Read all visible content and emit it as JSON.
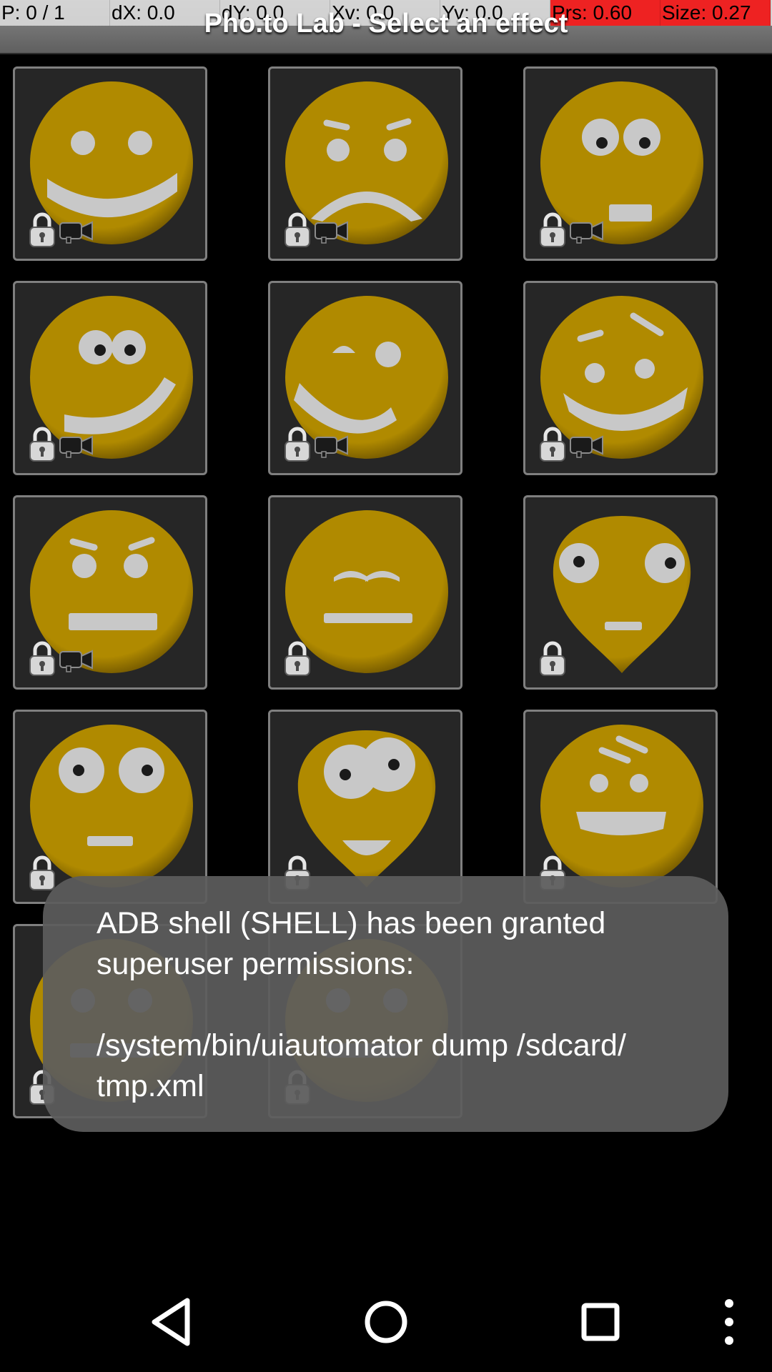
{
  "debug": {
    "cells": [
      {
        "text": "P: 0 / 1",
        "alert": false
      },
      {
        "text": "dX: 0.0",
        "alert": false
      },
      {
        "text": "dY: 0.0",
        "alert": false
      },
      {
        "text": "Xv: 0.0",
        "alert": false
      },
      {
        "text": "Yv: 0.0",
        "alert": false
      },
      {
        "text": "Prs: 0.60",
        "alert": true
      },
      {
        "text": "Size: 0.27",
        "alert": true
      }
    ]
  },
  "app": {
    "title": "Pho.to Lab - Select an effect"
  },
  "colors": {
    "face": "#b08a00",
    "face_dark": "#6e5400",
    "feature": "#c8c8c8",
    "pupil": "#1a1a1a"
  },
  "effects": [
    {
      "expression": "smile",
      "locked": true,
      "video": true
    },
    {
      "expression": "sad",
      "locked": true,
      "video": true
    },
    {
      "expression": "surprised",
      "locked": true,
      "video": true
    },
    {
      "expression": "crooked-smile",
      "locked": true,
      "video": true
    },
    {
      "expression": "wink",
      "locked": true,
      "video": true
    },
    {
      "expression": "smirk",
      "locked": true,
      "video": true
    },
    {
      "expression": "worried-flat",
      "locked": true,
      "video": true
    },
    {
      "expression": "bored",
      "locked": true,
      "video": false
    },
    {
      "expression": "alien",
      "locked": true,
      "video": false
    },
    {
      "expression": "stare",
      "locked": true,
      "video": false
    },
    {
      "expression": "pear-grin",
      "locked": true,
      "video": false
    },
    {
      "expression": "grin",
      "locked": true,
      "video": false
    },
    {
      "expression": "partial",
      "locked": true,
      "video": false
    },
    {
      "expression": "partial",
      "locked": true,
      "video": false
    }
  ],
  "toast": {
    "line1": "ADB shell (SHELL) has been granted superuser permissions:",
    "line2": "/system/bin/uiautomator dump /sdcard/ tmp.xml"
  },
  "navigation": {
    "icons": [
      "back-icon",
      "home-icon",
      "recents-icon",
      "overflow-menu-icon"
    ]
  }
}
